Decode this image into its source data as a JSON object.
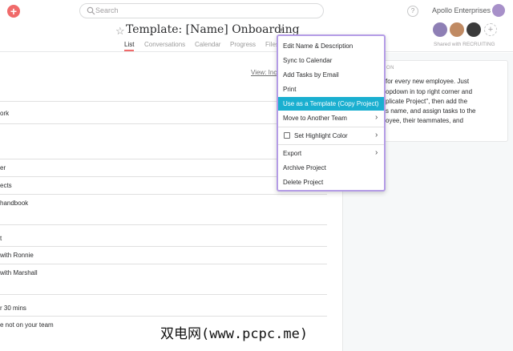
{
  "topbar": {
    "add_label": "+",
    "search_placeholder": "Search",
    "help_label": "?",
    "org_name": "Apollo Enterprises"
  },
  "project": {
    "title": "Template: [Name] Onboarding",
    "tabs": [
      "List",
      "Conversations",
      "Calendar",
      "Progress",
      "Files"
    ],
    "shared_label": "Shared with RECRUITING",
    "member_add_label": "+"
  },
  "task_list": {
    "view_filter": "View: Inc",
    "rows": [
      "ork",
      "",
      "er",
      "ects",
      "handbook",
      "",
      "t",
      "with Ronnie",
      "with Marshall",
      "",
      "r 30 mins",
      "e not on your team"
    ]
  },
  "description": {
    "heading": "ON",
    "lines": [
      "for every new employee.  Just",
      "opdown in top right corner and",
      "plicate Project\", then add the",
      "s name, and assign tasks to the",
      "oyee, their teammates, and"
    ]
  },
  "menu": {
    "items": [
      {
        "label": "Edit Name & Description"
      },
      {
        "label": "Sync to Calendar"
      },
      {
        "label": "Add Tasks by Email"
      },
      {
        "label": "Print"
      },
      {
        "label": "Use as a Template (Copy Project)"
      },
      {
        "label": "Move to Another Team"
      },
      {
        "label": "Set Highlight Color"
      },
      {
        "label": "Export"
      },
      {
        "label": "Archive Project"
      },
      {
        "label": "Delete Project"
      }
    ],
    "highlight_color": "#1aafd0",
    "border_color": "#b49ce6"
  },
  "watermark": "双电网(www.pcpc.me)"
}
